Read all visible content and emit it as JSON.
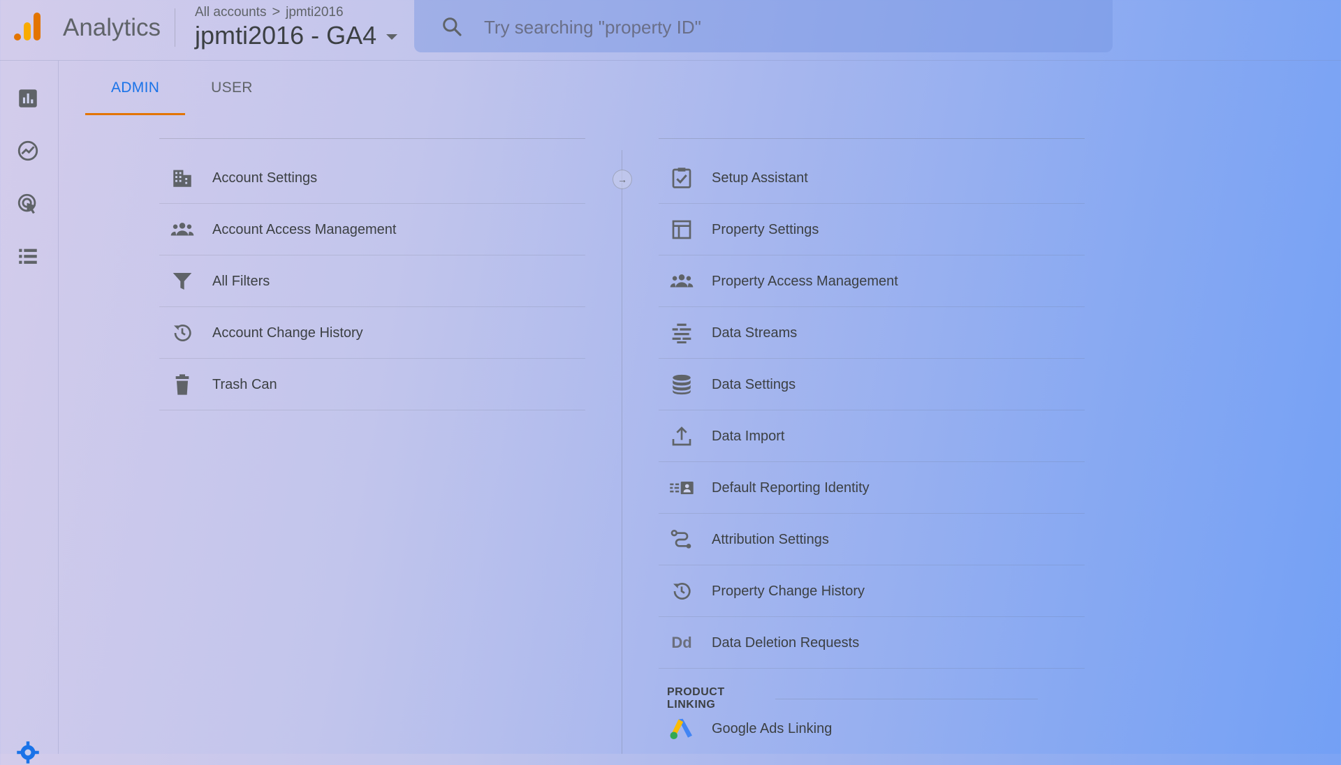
{
  "header": {
    "app_name": "Analytics",
    "breadcrumb": {
      "all_accounts": "All accounts",
      "separator": ">",
      "account": "jpmti2016"
    },
    "property": "jpmti2016 - GA4",
    "search_placeholder": "Try searching \"property ID\""
  },
  "left_nav": {
    "icons": [
      "reports-icon",
      "explore-icon",
      "advertising-icon",
      "configure-icon",
      "admin-gear-icon"
    ]
  },
  "tabs": [
    {
      "label": "ADMIN",
      "active": true
    },
    {
      "label": "USER",
      "active": false
    }
  ],
  "account_column": {
    "items": [
      {
        "label": "Account Settings",
        "icon": "building-icon"
      },
      {
        "label": "Account Access Management",
        "icon": "people-icon"
      },
      {
        "label": "All Filters",
        "icon": "filter-icon"
      },
      {
        "label": "Account Change History",
        "icon": "history-icon"
      },
      {
        "label": "Trash Can",
        "icon": "trash-icon"
      }
    ]
  },
  "property_column": {
    "items": [
      {
        "label": "Setup Assistant",
        "icon": "checkbox-icon"
      },
      {
        "label": "Property Settings",
        "icon": "property-layout-icon"
      },
      {
        "label": "Property Access Management",
        "icon": "people-icon"
      },
      {
        "label": "Data Streams",
        "icon": "streams-icon"
      },
      {
        "label": "Data Settings",
        "icon": "database-icon"
      },
      {
        "label": "Data Import",
        "icon": "upload-icon"
      },
      {
        "label": "Default Reporting Identity",
        "icon": "identity-icon"
      },
      {
        "label": "Attribution Settings",
        "icon": "attribution-icon"
      },
      {
        "label": "Property Change History",
        "icon": "history-icon"
      },
      {
        "label": "Data Deletion Requests",
        "icon": "dd-icon",
        "icon_text": "Dd"
      }
    ],
    "section_heading": "PRODUCT LINKING",
    "linking_items": [
      {
        "label": "Google Ads Linking",
        "icon": "google-ads-icon"
      }
    ]
  },
  "colors": {
    "accent_blue": "#1a73e8",
    "tab_underline": "#e37400",
    "logo_orange": "#f9ab00",
    "logo_dark_orange": "#e37400"
  }
}
